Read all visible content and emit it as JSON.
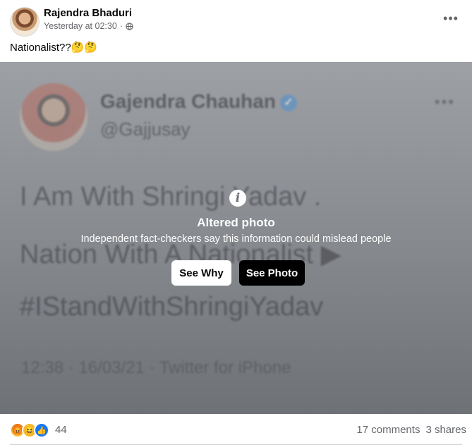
{
  "post": {
    "author": "Rajendra Bhaduri",
    "timestamp": "Yesterday at 02:30",
    "separator": "·",
    "privacy_icon": "globe-icon",
    "more_icon_text": "•••",
    "caption": "Nationalist??🤔🤔"
  },
  "tweet_blurred": {
    "name": "Gajendra Chauhan",
    "verified_icon": "✓",
    "handle": "@Gajjusay",
    "more": "•••",
    "line1": "I Am With Shringi Yadav .",
    "line2": "Nation With A Nationalist ▶",
    "line3": "#IStandWithShringiYadav",
    "meta": "12:38 · 16/03/21 · Twitter for iPhone"
  },
  "overlay": {
    "icon": "i",
    "title": "Altered photo",
    "description": "Independent fact-checkers say this information could mislead people",
    "see_why": "See Why",
    "see_photo": "See Photo"
  },
  "footer": {
    "reactions": [
      {
        "name": "angry",
        "glyph": "😡"
      },
      {
        "name": "haha",
        "glyph": "😆"
      },
      {
        "name": "like",
        "glyph": "👍"
      }
    ],
    "reaction_count": "44",
    "comments": "17 comments",
    "shares": "3 shares"
  },
  "colors": {
    "accent": "#1877f2",
    "muted_text": "#65676b",
    "overlay_button_dark": "#000000"
  }
}
